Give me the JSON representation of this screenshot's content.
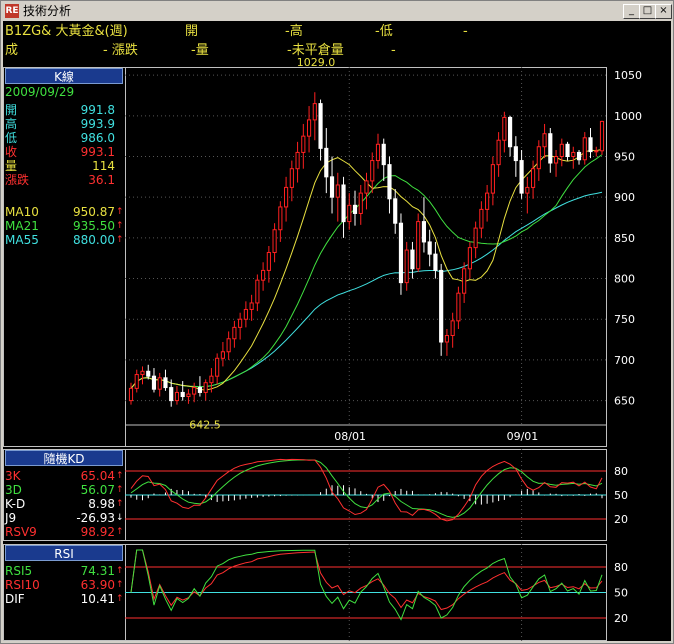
{
  "window": {
    "title": "技術分析",
    "app_icon_text": "RE",
    "minimize": "_",
    "maximize": "□",
    "close": "×"
  },
  "header": {
    "line1": [
      {
        "t": "B1ZG& 大黃金&(週)",
        "c": "#e8e040",
        "x": 2
      },
      {
        "t": "開",
        "c": "#e8e040",
        "x": 182
      },
      {
        "t": "-高",
        "c": "#e8e040",
        "x": 282
      },
      {
        "t": "-低",
        "c": "#e8e040",
        "x": 372
      },
      {
        "t": "-",
        "c": "#e8e040",
        "x": 460
      }
    ],
    "line2": [
      {
        "t": "成",
        "c": "#e8e040",
        "x": 2
      },
      {
        "t": "- 漲跌",
        "c": "#e8e040",
        "x": 100
      },
      {
        "t": "-量",
        "c": "#e8e040",
        "x": 188
      },
      {
        "t": "-未平倉量",
        "c": "#e8e040",
        "x": 284
      },
      {
        "t": "-",
        "c": "#e8e040",
        "x": 388
      }
    ]
  },
  "kpanel": {
    "title": "K線",
    "date": "2009/09/29",
    "rows": [
      {
        "label": "開",
        "value": "991.8",
        "color": "#40e0e0"
      },
      {
        "label": "高",
        "value": "993.9",
        "color": "#40e0e0"
      },
      {
        "label": "低",
        "value": "986.0",
        "color": "#40e0e0"
      },
      {
        "label": "收",
        "value": "993.1",
        "color": "#ff3030"
      },
      {
        "label": "量",
        "value": "114",
        "color": "#e8e040"
      },
      {
        "label": "漲跌",
        "value": "36.1",
        "color": "#ff3030"
      }
    ],
    "ma": [
      {
        "label": "MA10",
        "value": "950.87",
        "color": "#e8e040",
        "arrow": "↑",
        "arrow_color": "#ff3030"
      },
      {
        "label": "MA21",
        "value": "935.50",
        "color": "#40e040",
        "arrow": "↑",
        "arrow_color": "#ff3030"
      },
      {
        "label": "MA55",
        "value": "880.00",
        "color": "#40e0e0",
        "arrow": "↑",
        "arrow_color": "#ff3030"
      }
    ]
  },
  "kdpanel": {
    "title": "隨機KD",
    "rows": [
      {
        "label": "3K",
        "value": "65.04",
        "color": "#ff3030",
        "arrow": "↑",
        "arrow_color": "#ff3030"
      },
      {
        "label": "3D",
        "value": "56.07",
        "color": "#40e040",
        "arrow": "↑",
        "arrow_color": "#ff3030"
      },
      {
        "label": "K-D",
        "value": "8.98",
        "color": "#ffffff",
        "arrow": "↑",
        "arrow_color": "#ff3030"
      },
      {
        "label": "J9",
        "value": "-26.93",
        "color": "#ffffff",
        "arrow": "↓",
        "arrow_color": "#ffffff"
      },
      {
        "label": "RSV9",
        "value": "98.92",
        "color": "#ff3030",
        "arrow": "↑",
        "arrow_color": "#ff3030"
      }
    ]
  },
  "rsipanel": {
    "title": "RSI",
    "rows": [
      {
        "label": "RSI5",
        "value": "74.31",
        "color": "#40e040",
        "arrow": "↑",
        "arrow_color": "#ff3030"
      },
      {
        "label": "RSI10",
        "value": "63.90",
        "color": "#ff3030",
        "arrow": "↑",
        "arrow_color": "#ff3030"
      },
      {
        "label": "DIF",
        "value": "10.41",
        "color": "#ffffff",
        "arrow": "↑",
        "arrow_color": "#ff3030"
      }
    ]
  },
  "chart_data": [
    {
      "type": "candlestick",
      "y_ticks": [
        650,
        700,
        750,
        800,
        850,
        900,
        950,
        1000,
        1050
      ],
      "ylim": [
        620,
        1060
      ],
      "x_labels": [
        "08/01",
        "09/01"
      ],
      "annotations": [
        {
          "text": "1029.0",
          "value": 1029.0
        },
        {
          "text": "642.5",
          "value": 642.5
        }
      ],
      "colors": {
        "up": "#ff2020",
        "down": "#ffffff",
        "ma10": "#e8e040",
        "ma21": "#40e040",
        "ma55": "#40e0e0"
      },
      "candles": [
        [
          650,
          672,
          645,
          665
        ],
        [
          665,
          688,
          660,
          682
        ],
        [
          682,
          692,
          670,
          686
        ],
        [
          686,
          694,
          676,
          680
        ],
        [
          680,
          690,
          660,
          664
        ],
        [
          664,
          684,
          655,
          678
        ],
        [
          678,
          688,
          662,
          666
        ],
        [
          666,
          676,
          642.5,
          650
        ],
        [
          650,
          668,
          645,
          660
        ],
        [
          660,
          674,
          650,
          655
        ],
        [
          655,
          664,
          646,
          658
        ],
        [
          658,
          672,
          648,
          666
        ],
        [
          666,
          680,
          655,
          660
        ],
        [
          660,
          676,
          650,
          672
        ],
        [
          672,
          690,
          660,
          680
        ],
        [
          680,
          708,
          670,
          702
        ],
        [
          702,
          722,
          692,
          710
        ],
        [
          710,
          735,
          700,
          726
        ],
        [
          726,
          748,
          715,
          740
        ],
        [
          740,
          758,
          725,
          750
        ],
        [
          750,
          772,
          740,
          762
        ],
        [
          762,
          780,
          748,
          770
        ],
        [
          770,
          805,
          760,
          798
        ],
        [
          798,
          820,
          785,
          810
        ],
        [
          810,
          840,
          795,
          832
        ],
        [
          832,
          868,
          820,
          860
        ],
        [
          860,
          895,
          845,
          888
        ],
        [
          888,
          925,
          870,
          912
        ],
        [
          912,
          945,
          895,
          935
        ],
        [
          935,
          968,
          918,
          955
        ],
        [
          955,
          990,
          935,
          975
        ],
        [
          975,
          1012,
          955,
          995
        ],
        [
          995,
          1029,
          970,
          1015
        ],
        [
          1015,
          1020,
          945,
          960
        ],
        [
          960,
          985,
          905,
          925
        ],
        [
          925,
          950,
          880,
          900
        ],
        [
          900,
          930,
          870,
          915
        ],
        [
          915,
          925,
          850,
          870
        ],
        [
          870,
          905,
          860,
          890
        ],
        [
          890,
          908,
          865,
          880
        ],
        [
          880,
          915,
          866,
          905
        ],
        [
          905,
          930,
          885,
          920
        ],
        [
          920,
          955,
          905,
          945
        ],
        [
          945,
          978,
          935,
          965
        ],
        [
          965,
          972,
          920,
          940
        ],
        [
          940,
          950,
          880,
          898
        ],
        [
          898,
          910,
          855,
          868
        ],
        [
          868,
          880,
          780,
          795
        ],
        [
          795,
          845,
          785,
          835
        ],
        [
          835,
          845,
          800,
          812
        ],
        [
          812,
          880,
          808,
          870
        ],
        [
          870,
          900,
          832,
          845
        ],
        [
          845,
          860,
          815,
          830
        ],
        [
          830,
          845,
          800,
          810
        ],
        [
          810,
          818,
          705,
          722
        ],
        [
          722,
          738,
          705,
          730
        ],
        [
          730,
          758,
          715,
          748
        ],
        [
          748,
          790,
          738,
          782
        ],
        [
          782,
          820,
          770,
          812
        ],
        [
          812,
          845,
          800,
          838
        ],
        [
          838,
          870,
          825,
          862
        ],
        [
          862,
          895,
          850,
          885
        ],
        [
          885,
          915,
          870,
          905
        ],
        [
          905,
          950,
          890,
          940
        ],
        [
          940,
          980,
          925,
          970
        ],
        [
          970,
          1005,
          955,
          998
        ],
        [
          998,
          1000,
          950,
          962
        ],
        [
          962,
          975,
          925,
          945
        ],
        [
          945,
          958,
          898,
          905
        ],
        [
          905,
          925,
          880,
          912
        ],
        [
          912,
          945,
          898,
          935
        ],
        [
          935,
          970,
          920,
          962
        ],
        [
          962,
          990,
          948,
          978
        ],
        [
          978,
          985,
          930,
          942
        ],
        [
          942,
          958,
          925,
          950
        ],
        [
          950,
          972,
          938,
          965
        ],
        [
          965,
          968,
          945,
          950
        ],
        [
          950,
          962,
          935,
          955
        ],
        [
          955,
          958,
          940,
          946
        ],
        [
          946,
          980,
          940,
          973
        ],
        [
          973,
          985,
          948,
          956
        ],
        [
          956,
          962,
          950,
          957
        ],
        [
          957,
          994,
          952,
          993.1
        ]
      ]
    },
    {
      "type": "line",
      "name_series": [
        "3K",
        "3D"
      ],
      "y_ticks": [
        20,
        50,
        80
      ],
      "ylim": [
        0,
        100
      ]
    },
    {
      "type": "line",
      "name_series": [
        "RSI5",
        "RSI10"
      ],
      "y_ticks": [
        20,
        50,
        80
      ],
      "ylim": [
        0,
        100
      ]
    }
  ]
}
